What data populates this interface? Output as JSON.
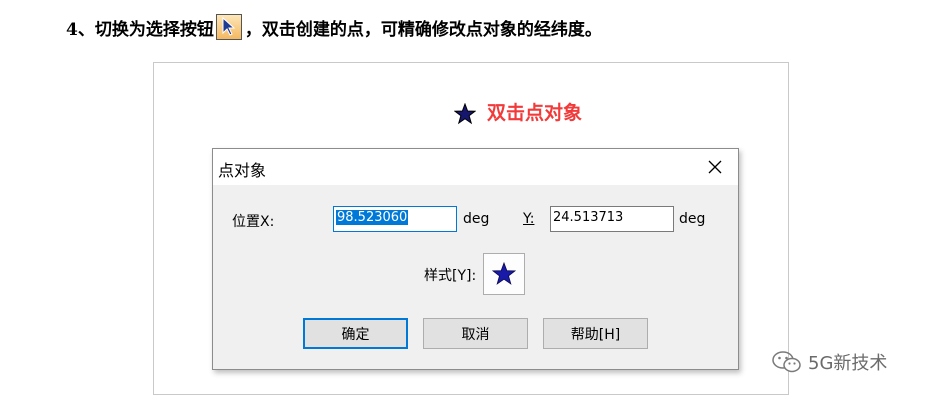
{
  "instruction": {
    "before": "4、切换为选择按钮",
    "after": "，双击创建的点，可精确修改点对象的经纬度。",
    "tool_icon": "arrow-cursor-icon"
  },
  "canvas": {
    "point_icon": "star-icon",
    "point_caption": "双击点对象"
  },
  "dialog": {
    "title": "点对象",
    "close_icon": "close-icon",
    "x_label": "位置X:",
    "x_value": "98.523060",
    "x_unit": "deg",
    "y_label": "Y:",
    "y_value": "24.513713",
    "y_unit": "deg",
    "style_label": "样式[Y]:",
    "style_icon": "star-icon",
    "ok_label": "确定",
    "cancel_label": "取消",
    "help_label": "帮助[H]"
  },
  "watermark": {
    "icon": "wechat-icon",
    "text": "5G新技术"
  },
  "colors": {
    "caption_red": "#f23a3a",
    "star_blue": "#1a1aa8",
    "focus_blue": "#0078d7"
  }
}
